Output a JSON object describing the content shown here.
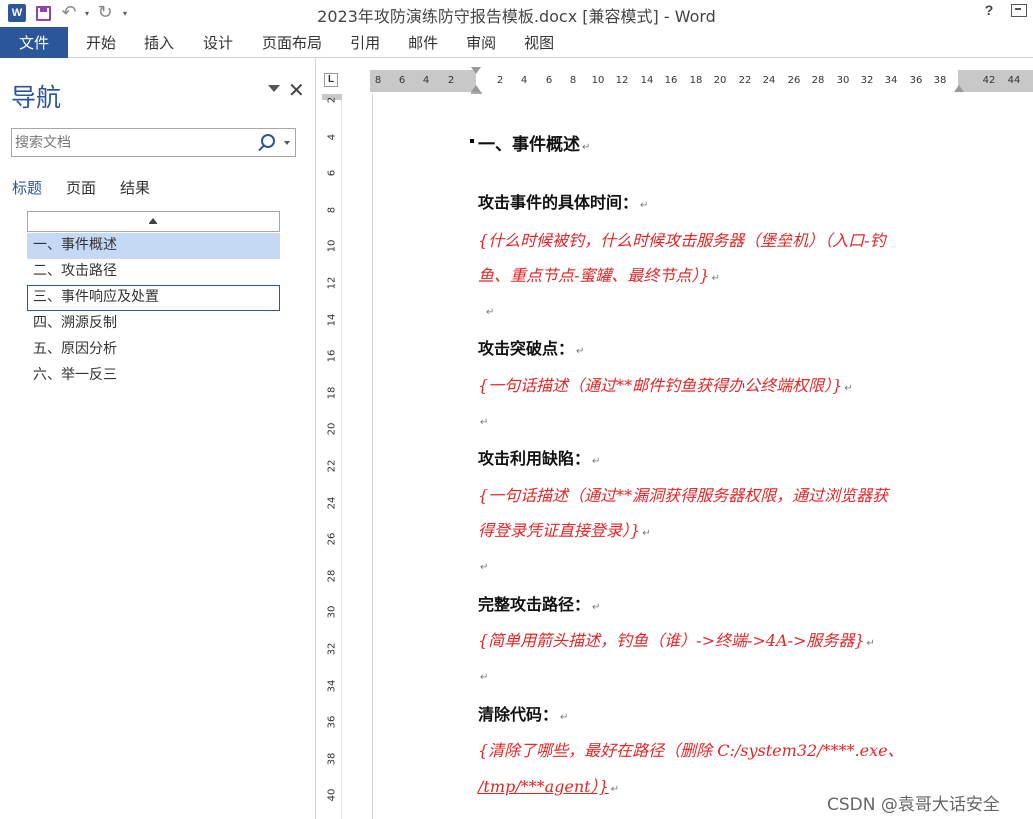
{
  "window": {
    "title": "2023年攻防演练防守报告模板.docx [兼容模式] - Word",
    "app_icon_text": "W",
    "help_label": "?"
  },
  "ribbon": {
    "tabs": [
      "文件",
      "开始",
      "插入",
      "设计",
      "页面布局",
      "引用",
      "邮件",
      "审阅",
      "视图"
    ]
  },
  "nav": {
    "title": "导航",
    "close_label": "✕",
    "search_placeholder": "搜索文档",
    "tabs": [
      "标题",
      "页面",
      "结果"
    ],
    "headings": [
      "一、事件概述",
      "二、攻击路径",
      "三、事件响应及处置",
      "四、溯源反制",
      "五、原因分析",
      "六、举一反三"
    ]
  },
  "ruler": {
    "corner": "L",
    "h_ticks": [
      "8",
      "6",
      "4",
      "2",
      "2",
      "4",
      "6",
      "8",
      "10",
      "12",
      "14",
      "16",
      "18",
      "20",
      "22",
      "24",
      "26",
      "28",
      "30",
      "32",
      "34",
      "36",
      "38",
      "42",
      "44"
    ],
    "v_ticks": [
      "2",
      "4",
      "6",
      "8",
      "10",
      "12",
      "14",
      "16",
      "18",
      "20",
      "22",
      "24",
      "26",
      "28",
      "30",
      "32",
      "34",
      "36",
      "38",
      "40"
    ]
  },
  "document": {
    "heading": "一、事件概述",
    "mark": "↵",
    "sections": [
      {
        "label": "攻击事件的具体时间：",
        "lines": [
          "{什么时候被钓，什么时候攻击服务器（堡垒机）（入口-钓",
          "鱼、重点节点-蜜罐、最终节点）}"
        ]
      },
      {
        "label": "攻击突破点：",
        "lines": [
          "{一句话描述（通过**邮件钓鱼获得办公终端权限）}"
        ]
      },
      {
        "label": "攻击利用缺陷：",
        "lines": [
          "{一句话描述（通过**漏洞获得服务器权限，通过浏览器获",
          "得登录凭证直接登录）}"
        ]
      },
      {
        "label": "完整攻击路径：",
        "lines": [
          "{简单用箭头描述，钓鱼（谁）->终端->4A->服务器}"
        ]
      },
      {
        "label": "清除代码：",
        "lines": [
          "{清除了哪些，最好在路径（删除 C:/system32/****.exe、",
          "/tmp/***agent）}"
        ]
      }
    ]
  },
  "watermark": "CSDN @袁哥大话安全"
}
